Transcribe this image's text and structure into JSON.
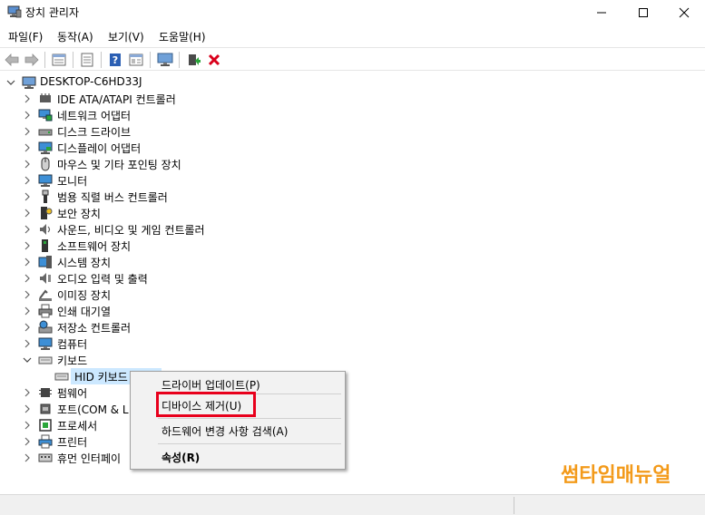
{
  "window": {
    "title": "장치 관리자",
    "minimize_glyph": "—",
    "maximize_glyph": "☐",
    "close_glyph": "✕"
  },
  "menu": [
    {
      "label": "파일(F)"
    },
    {
      "label": "동작(A)"
    },
    {
      "label": "보기(V)"
    },
    {
      "label": "도움말(H)"
    }
  ],
  "toolbar": {
    "buttons": [
      "back-icon",
      "forward-icon",
      "properties-grid-icon",
      "list-icon",
      "help-icon",
      "details-icon",
      "scan-monitor-icon",
      "update-driver-icon",
      "uninstall-icon"
    ],
    "uninstall_color": "#d9001b",
    "help_color": "#2b5fb3"
  },
  "tree": {
    "root": "DESKTOP-C6HD33J",
    "items": [
      {
        "label": "IDE ATA/ATAPI 컨트롤러",
        "icon": "ide-controller-icon"
      },
      {
        "label": "네트워크 어댑터",
        "icon": "network-adapter-icon"
      },
      {
        "label": "디스크 드라이브",
        "icon": "disk-drive-icon"
      },
      {
        "label": "디스플레이 어댑터",
        "icon": "display-adapter-icon"
      },
      {
        "label": "마우스 및 기타 포인팅 장치",
        "icon": "mouse-icon"
      },
      {
        "label": "모니터",
        "icon": "monitor-icon"
      },
      {
        "label": "범용 직렬 버스 컨트롤러",
        "icon": "usb-icon"
      },
      {
        "label": "보안 장치",
        "icon": "security-device-icon"
      },
      {
        "label": "사운드, 비디오 및 게임 컨트롤러",
        "icon": "sound-icon"
      },
      {
        "label": "소프트웨어 장치",
        "icon": "software-device-icon"
      },
      {
        "label": "시스템 장치",
        "icon": "system-device-icon"
      },
      {
        "label": "오디오 입력 및 출력",
        "icon": "audio-io-icon"
      },
      {
        "label": "이미징 장치",
        "icon": "imaging-device-icon"
      },
      {
        "label": "인쇄 대기열",
        "icon": "print-queue-icon"
      },
      {
        "label": "저장소 컨트롤러",
        "icon": "storage-controller-icon"
      },
      {
        "label": "컴퓨터",
        "icon": "computer-icon"
      },
      {
        "label": "키보드",
        "icon": "keyboard-icon"
      },
      {
        "label": "HID 키보드",
        "icon": "keyboard-icon"
      },
      {
        "label": "펌웨어",
        "icon": "firmware-icon"
      },
      {
        "label": "포트(COM & L",
        "icon": "port-icon"
      },
      {
        "label": "프로세서",
        "icon": "processor-icon"
      },
      {
        "label": "프린터",
        "icon": "printer-icon"
      },
      {
        "label": "휴먼 인터페이",
        "icon": "hid-icon"
      }
    ]
  },
  "context_menu": {
    "items": [
      {
        "label": "드라이버 업데이트(P)"
      },
      {
        "label": "디바이스 제거(U)"
      },
      {
        "label": "하드웨어 변경 사항 검색(A)"
      },
      {
        "label": "속성(R)"
      }
    ],
    "highlight_color": "#e8001c"
  },
  "watermark": {
    "text": "썸타임매뉴얼",
    "color": "#f39a1a"
  }
}
